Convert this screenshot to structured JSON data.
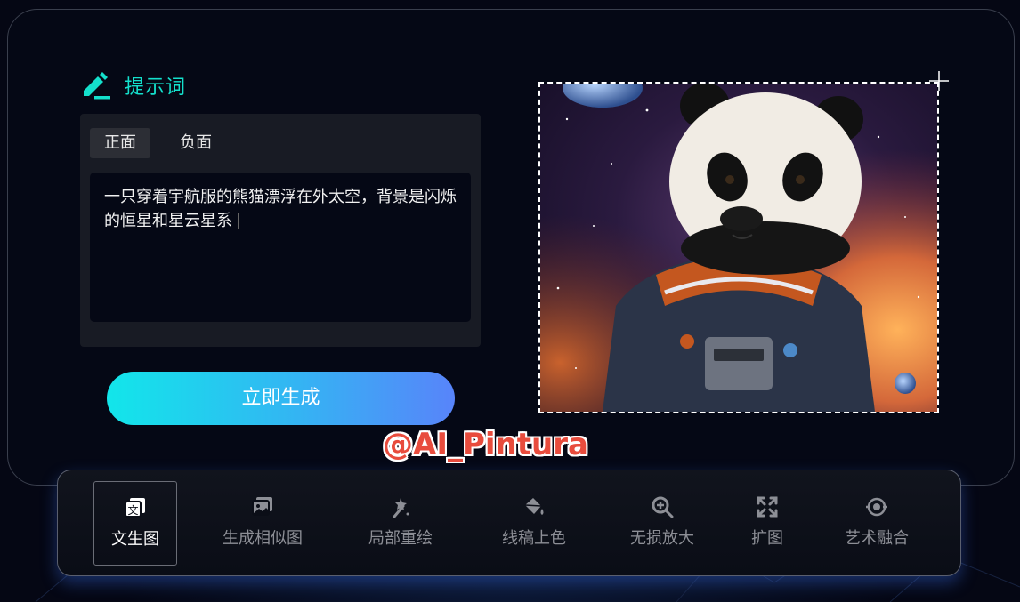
{
  "prompt_section": {
    "title": "提示词",
    "tabs": [
      {
        "label": "正面",
        "active": true
      },
      {
        "label": "负面",
        "active": false
      }
    ],
    "prompt_text": "一只穿着宇航服的熊猫漂浮在外太空，背景是闪烁的恒星和星云星系"
  },
  "generate_button": {
    "label": "立即生成"
  },
  "watermark": "@AI_Pintura",
  "toolbar": {
    "items": [
      {
        "label": "文生图",
        "icon": "text-to-image-icon",
        "active": true
      },
      {
        "label": "生成相似图",
        "icon": "image-icon",
        "active": false
      },
      {
        "label": "局部重绘",
        "icon": "magic-wand-icon",
        "active": false
      },
      {
        "label": "线稿上色",
        "icon": "paint-bucket-icon",
        "active": false
      },
      {
        "label": "无损放大",
        "icon": "zoom-in-icon",
        "active": false
      },
      {
        "label": "扩图",
        "icon": "expand-icon",
        "active": false
      },
      {
        "label": "艺术融合",
        "icon": "blend-icon",
        "active": false
      }
    ]
  },
  "colors": {
    "accent": "#14e0cc",
    "button_gradient_start": "#12e6ea",
    "button_gradient_end": "#5884fa",
    "watermark": "#e84c3d"
  }
}
